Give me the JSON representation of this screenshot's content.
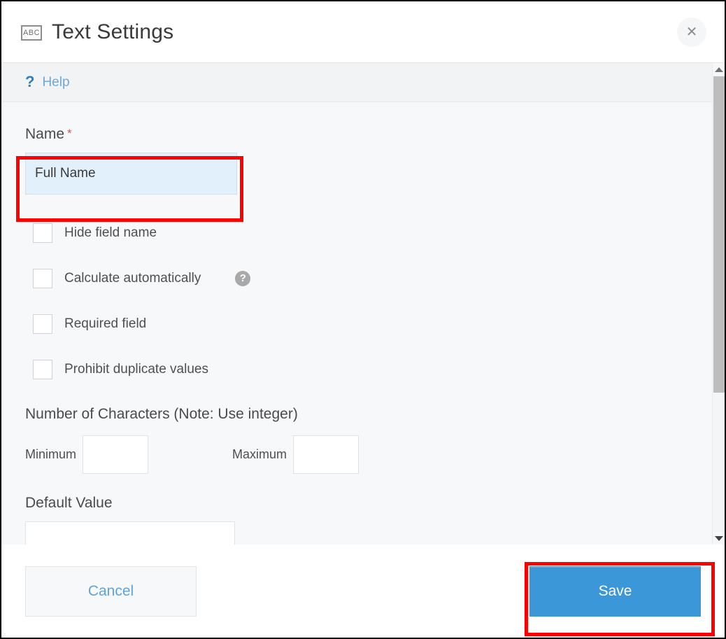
{
  "header": {
    "icon": "abc-text-field-icon",
    "icon_text": "ABC",
    "title": "Text Settings",
    "close_label": "✕"
  },
  "help": {
    "icon": "question-mark-icon",
    "icon_text": "?",
    "label": "Help"
  },
  "form": {
    "name": {
      "label": "Name",
      "required_marker": "*",
      "value": "Full Name",
      "placeholder": ""
    },
    "checkboxes": [
      {
        "label": "Hide field name",
        "checked": false,
        "has_info": false
      },
      {
        "label": "Calculate automatically",
        "checked": false,
        "has_info": true,
        "info_text": "?"
      },
      {
        "label": "Required field",
        "checked": false,
        "has_info": false
      },
      {
        "label": "Prohibit duplicate values",
        "checked": false,
        "has_info": false
      }
    ],
    "characters": {
      "heading": "Number of Characters (Note: Use integer)",
      "minimum_label": "Minimum",
      "minimum_value": "",
      "maximum_label": "Maximum",
      "maximum_value": ""
    },
    "default_value": {
      "heading": "Default Value",
      "value": "",
      "placeholder": ""
    }
  },
  "scrollbar": {
    "up_arrow": "scroll-up-arrow",
    "down_arrow": "scroll-down-arrow"
  },
  "footer": {
    "cancel_label": "Cancel",
    "save_label": "Save"
  },
  "annotations": {
    "color": "#fe0000",
    "name_field_highlight": "name-input",
    "save_button_highlight": "save-button"
  }
}
